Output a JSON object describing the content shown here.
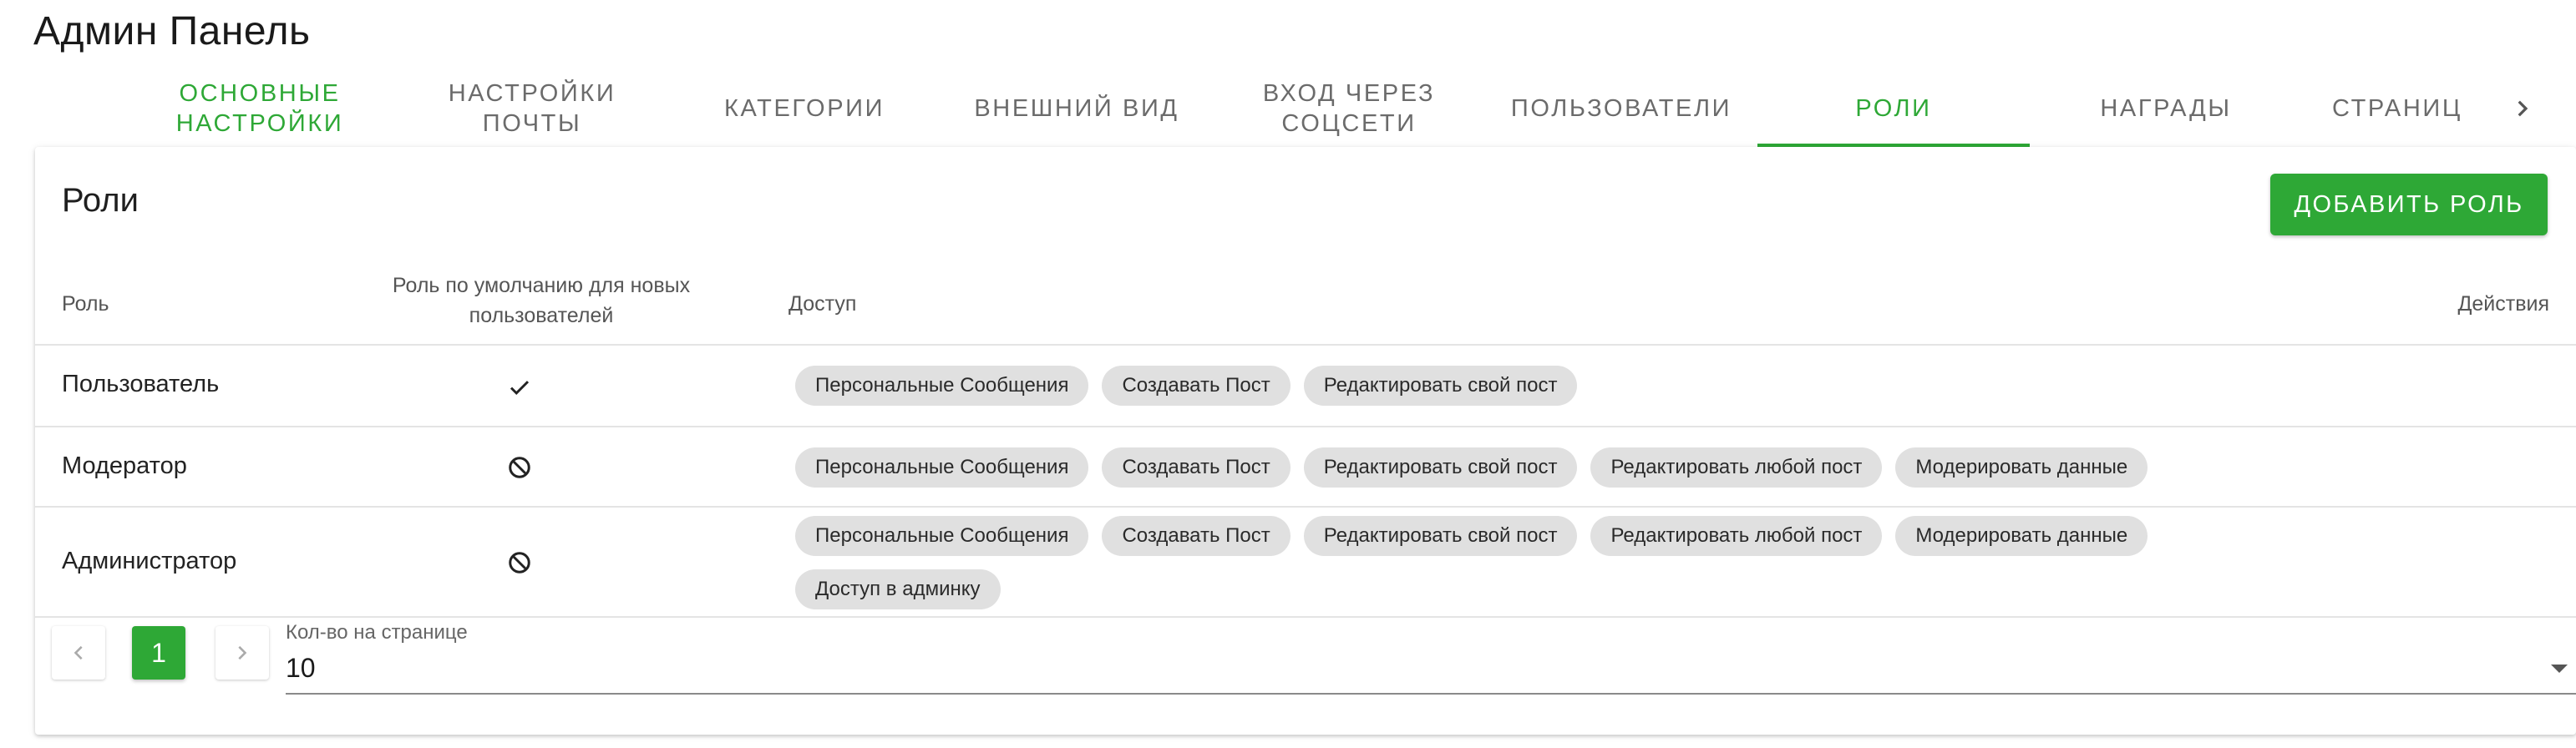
{
  "page_title": "Админ Панель",
  "tabs": [
    {
      "label": "ОСНОВНЫЕ\nНАСТРОЙКИ"
    },
    {
      "label": "НАСТРОЙКИ\nПОЧТЫ"
    },
    {
      "label": "КАТЕГОРИИ"
    },
    {
      "label": "ВНЕШНИЙ ВИД"
    },
    {
      "label": "ВХОД ЧЕРЕЗ\nСОЦСЕТИ"
    },
    {
      "label": "ПОЛЬЗОВАТЕЛИ"
    },
    {
      "label": "РОЛИ"
    },
    {
      "label": "НАГРАДЫ"
    },
    {
      "label": "СТРАНИЦ"
    }
  ],
  "card": {
    "title": "Роли",
    "add_button": "ДОБАВИТЬ РОЛЬ"
  },
  "table": {
    "headers": {
      "role": "Роль",
      "default": "Роль по умолчанию для новых пользователей",
      "access": "Доступ",
      "actions": "Действия"
    },
    "rows": [
      {
        "role": "Пользователь",
        "default_icon": "check-icon",
        "access": [
          "Персональные Сообщения",
          "Создавать Пост",
          "Редактировать свой пост"
        ]
      },
      {
        "role": "Модератор",
        "default_icon": "blocked-icon",
        "access": [
          "Персональные Сообщения",
          "Создавать Пост",
          "Редактировать свой пост",
          "Редактировать любой пост",
          "Модерировать данные"
        ]
      },
      {
        "role": "Администратор",
        "default_icon": "blocked-icon",
        "access": [
          "Персональные Сообщения",
          "Создавать Пост",
          "Редактировать свой пост",
          "Редактировать любой пост",
          "Модерировать данные",
          "Доступ в админку"
        ]
      }
    ]
  },
  "pagination": {
    "current_page": "1",
    "per_page_label": "Кол-во на странице",
    "per_page_value": "10"
  },
  "colors": {
    "accent": "#2ea836"
  }
}
